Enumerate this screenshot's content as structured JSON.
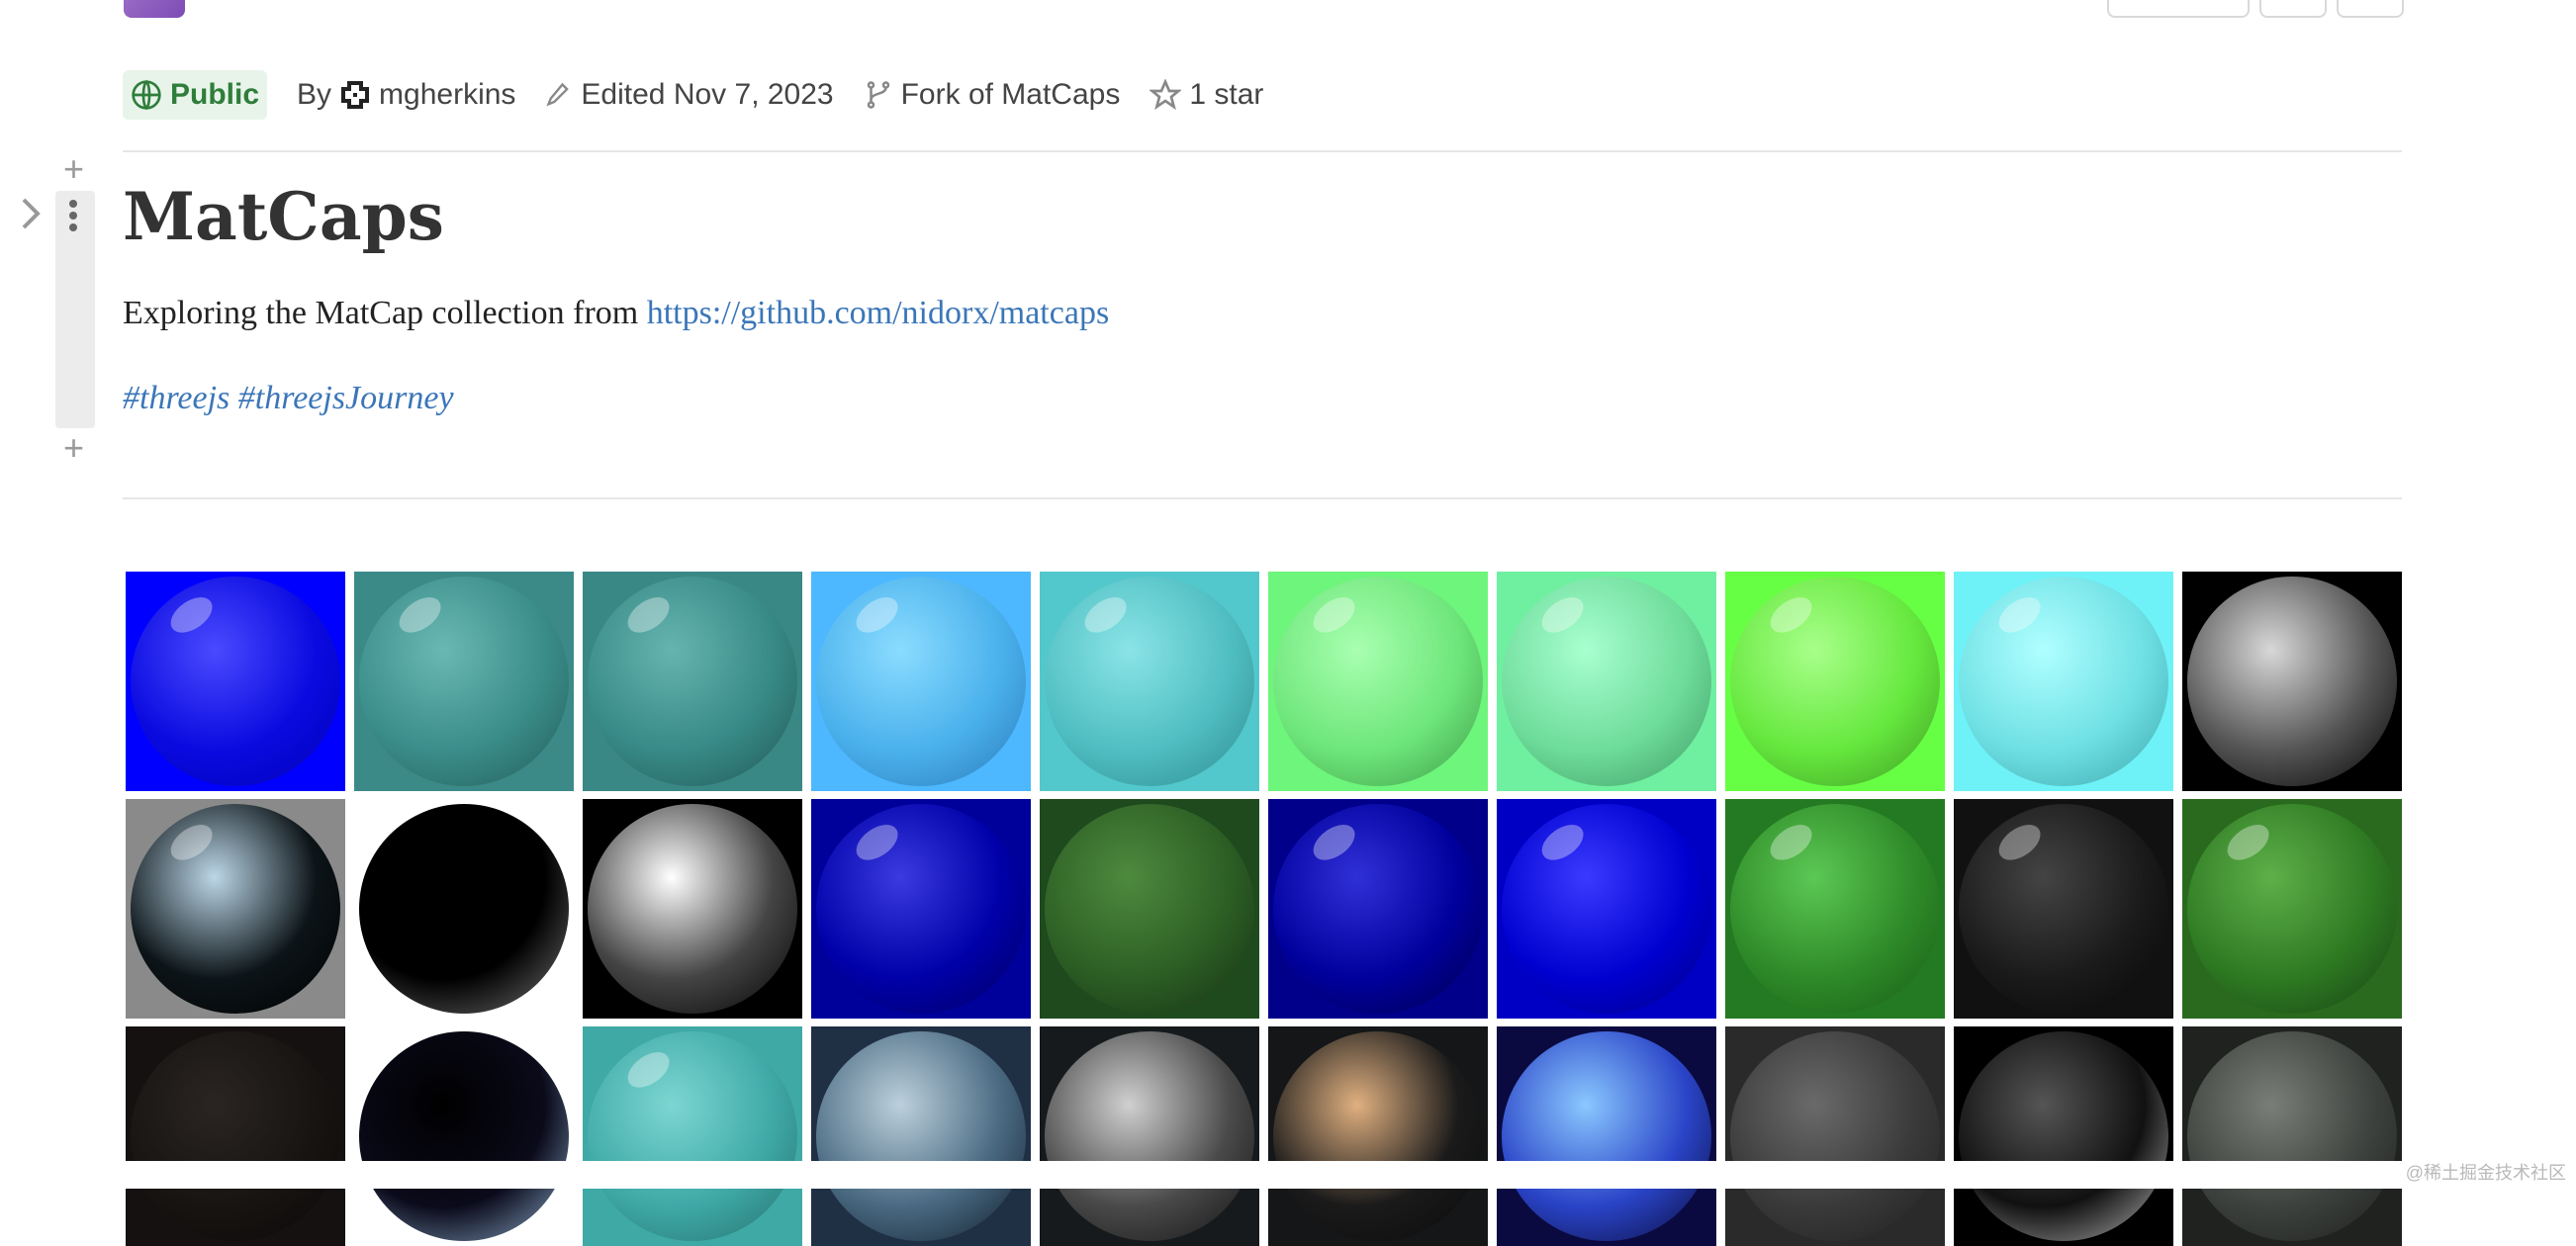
{
  "meta": {
    "visibility": "Public",
    "by_label": "By",
    "author": "mgherkins",
    "edited": "Edited Nov 7, 2023",
    "fork": "Fork of MatCaps",
    "stars": "1 star"
  },
  "notebook": {
    "title": "MatCaps",
    "description_prefix": "Exploring the MatCap collection from ",
    "link": "https://github.com/nidorx/matcaps",
    "tags": [
      "#threejs",
      "#threejsJourney"
    ]
  },
  "matcaps": [
    {
      "bg": "#0000ff",
      "c1": "#4a4aff",
      "c2": "#0a0ae0",
      "c3": "#0000b8",
      "gloss": true
    },
    {
      "bg": "#3c8a87",
      "c1": "#6ab8b4",
      "c2": "#3a8d8a",
      "c3": "#245b58",
      "gloss": true
    },
    {
      "bg": "#3a8886",
      "c1": "#66b4b0",
      "c2": "#378a87",
      "c3": "#225655",
      "gloss": true
    },
    {
      "bg": "#4db8ff",
      "c1": "#8adcff",
      "c2": "#4ab1ec",
      "c3": "#2a78b8",
      "gloss": true
    },
    {
      "bg": "#53c8cc",
      "c1": "#8ae4e6",
      "c2": "#4fbec2",
      "c3": "#2e8a8f",
      "gloss": true
    },
    {
      "bg": "#6ef57c",
      "c1": "#a8ffb0",
      "c2": "#6ee67a",
      "c3": "#3b9a46",
      "gloss": true
    },
    {
      "bg": "#6ff0a0",
      "c1": "#a8ffd0",
      "c2": "#6edc9a",
      "c3": "#3c9a62",
      "gloss": true
    },
    {
      "bg": "#66ff44",
      "c1": "#a8ff8a",
      "c2": "#66e83e",
      "c3": "#3c9a22",
      "gloss": true
    },
    {
      "bg": "#6ef2f7",
      "c1": "#b0ffff",
      "c2": "#6ee0e4",
      "c3": "#3aa4aa",
      "gloss": true
    },
    {
      "bg": "#000000",
      "c1": "#d8d8d8",
      "c2": "#555555",
      "c3": "#000000",
      "gloss": false
    },
    {
      "bg": "#8a8a8a",
      "c1": "#bcd7e8",
      "c2": "#0c1418",
      "c3": "#000000",
      "gloss": true
    },
    {
      "bg": "#ffffff",
      "c1": "#000000",
      "c2": "#000000",
      "c3": "#777777",
      "gloss": false
    },
    {
      "bg": "#000000",
      "c1": "#ffffff",
      "c2": "#444444",
      "c3": "#000000",
      "gloss": false
    },
    {
      "bg": "#00009a",
      "c1": "#3a3ae0",
      "c2": "#0000a8",
      "c3": "#000060",
      "gloss": true
    },
    {
      "bg": "#1e4a1e",
      "c1": "#4e8a3e",
      "c2": "#2c5e24",
      "c3": "#143014",
      "gloss": false
    },
    {
      "bg": "#00008a",
      "c1": "#3030d8",
      "c2": "#00009c",
      "c3": "#00004a",
      "gloss": true
    },
    {
      "bg": "#0000c4",
      "c1": "#3a3aff",
      "c2": "#0000d0",
      "c3": "#000088",
      "gloss": true
    },
    {
      "bg": "#247a22",
      "c1": "#5cc854",
      "c2": "#2e8a28",
      "c3": "#185a16",
      "gloss": true
    },
    {
      "bg": "#111111",
      "c1": "#444444",
      "c2": "#1a1a1a",
      "c3": "#050505",
      "gloss": true
    },
    {
      "bg": "#2a6a1e",
      "c1": "#5eb04a",
      "c2": "#2e7a22",
      "c3": "#164014",
      "gloss": true
    },
    {
      "bg": "#141110",
      "c1": "#2a2522",
      "c2": "#171412",
      "c3": "#0a0807",
      "gloss": false
    },
    {
      "bg": "#ffffff",
      "c1": "#000000",
      "c2": "#0a0a1a",
      "c3": "#8fb0d0",
      "gloss": false
    },
    {
      "bg": "#3fa9a6",
      "c1": "#7cd6d2",
      "c2": "#3fa9a6",
      "c3": "#24706d",
      "gloss": true
    },
    {
      "bg": "#203044",
      "c1": "#bcd0dc",
      "c2": "#4a6a82",
      "c3": "#0e1a28",
      "gloss": false
    },
    {
      "bg": "#161a1c",
      "c1": "#d0d0d0",
      "c2": "#4a4a4a",
      "c3": "#101010",
      "gloss": false
    },
    {
      "bg": "#141618",
      "c1": "#e0b080",
      "c2": "#1a1a1a",
      "c3": "#0a0a0a",
      "gloss": false
    },
    {
      "bg": "#0a0a40",
      "c1": "#8ac8ff",
      "c2": "#2a44c8",
      "c3": "#080830",
      "gloss": false
    },
    {
      "bg": "#2a2a2a",
      "c1": "#6a6a6a",
      "c2": "#3a3a3a",
      "c3": "#1e1e1e",
      "gloss": false
    },
    {
      "bg": "#000000",
      "c1": "#555555",
      "c2": "#111111",
      "c3": "#bdbdbd",
      "gloss": false
    },
    {
      "bg": "#202220",
      "c1": "#7a7e78",
      "c2": "#3e423e",
      "c3": "#1a1c1a",
      "gloss": false
    }
  ],
  "watermark": "@稀土掘金技术社区"
}
